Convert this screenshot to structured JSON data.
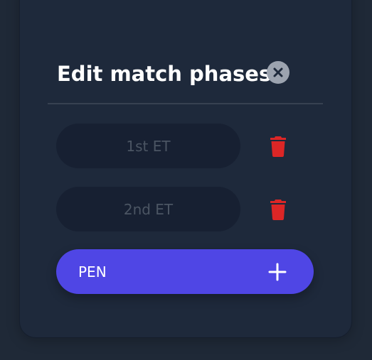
{
  "dialog": {
    "title": "Edit match phases",
    "close_icon": "close-circle-icon"
  },
  "phases": [
    {
      "name": "1st ET",
      "delete_icon": "trash-icon"
    },
    {
      "name": "2nd ET",
      "delete_icon": "trash-icon"
    }
  ],
  "new_phase": {
    "value": "PEN",
    "add_icon": "plus-icon"
  },
  "colors": {
    "background": "#1f2937",
    "panel": "#1e293b",
    "input_bg": "#172032",
    "input_text": "#4b5563",
    "accent": "#4f46e5",
    "danger": "#dc2626",
    "close_bg": "#9ca3af"
  }
}
